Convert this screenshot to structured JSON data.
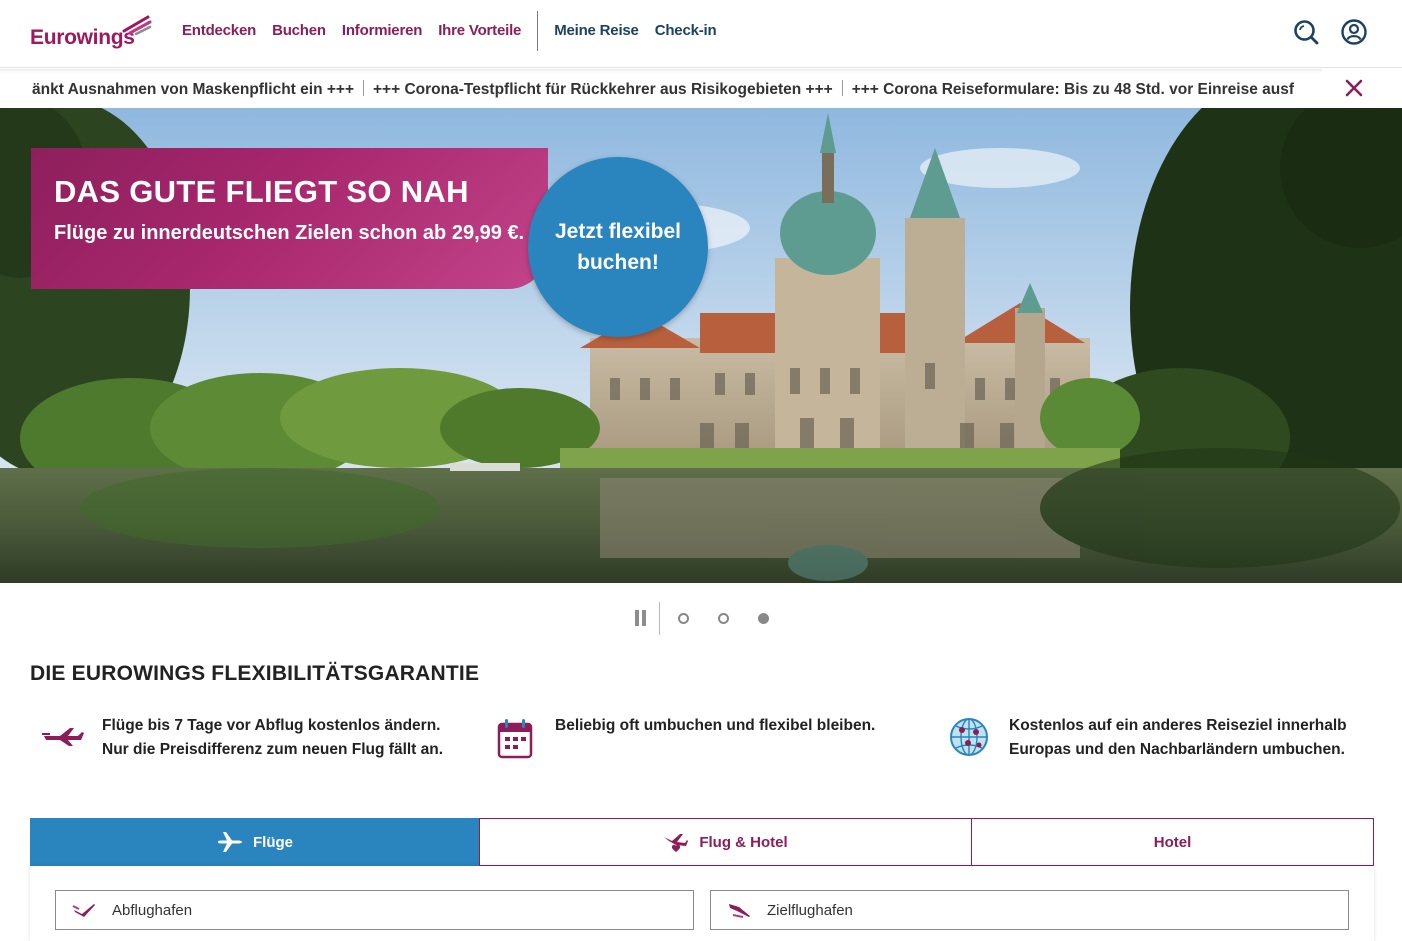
{
  "header": {
    "logo_text": "Eurowings",
    "nav_primary": [
      "Entdecken",
      "Buchen",
      "Informieren",
      "Ihre Vorteile"
    ],
    "nav_secondary": [
      "Meine Reise",
      "Check-in"
    ],
    "icons": [
      "search-icon",
      "user-account-icon"
    ],
    "brand_color": "#8c1d59",
    "secondary_color": "#1c4262"
  },
  "ticker": {
    "items": [
      "änkt Ausnahmen von Maskenpflicht ein +++",
      "+++ Corona-Testpflicht für Rückkehrer aus Risikogebieten +++",
      "+++ Corona Reiseformulare: Bis zu 48 Std. vor Einreise ausf"
    ],
    "close_icon": "close-icon"
  },
  "hero": {
    "title": "DAS GUTE FLIEGT SO NAH",
    "subtitle": "Flüge zu innerdeutschen Zielen schon ab 29,99 €.",
    "cta_line1": "Jetzt flexibel",
    "cta_line2": "buchen!",
    "cta_color": "#2a84bd",
    "promo_color": "#a8276d"
  },
  "carousel": {
    "slides": 3,
    "active_slide": 3
  },
  "guarantee": {
    "title": "DIE EUROWINGS FLEXIBILITÄTSGARANTIE",
    "features": [
      {
        "icon": "airplane-icon",
        "line1": "Flüge bis 7 Tage vor Abflug kostenlos ändern.",
        "line2": "Nur die Preisdifferenz zum neuen Flug fällt an."
      },
      {
        "icon": "calendar-icon",
        "line1": "Beliebig oft umbuchen und flexibel bleiben.",
        "line2": ""
      },
      {
        "icon": "globe-icon",
        "line1": "Kostenlos auf ein anderes Reiseziel innerhalb",
        "line2": "Europas und den Nachbarländern umbuchen."
      }
    ]
  },
  "booking": {
    "tabs": [
      {
        "label": "Flüge",
        "icon": "airplane-icon",
        "active": true
      },
      {
        "label": "Flug & Hotel",
        "icon": "plane-heart-icon",
        "active": false
      },
      {
        "label": "Hotel",
        "icon": "",
        "active": false
      }
    ],
    "fields": [
      {
        "placeholder": "Abflughafen",
        "icon": "departure-icon"
      },
      {
        "placeholder": "Zielflughafen",
        "icon": "arrival-icon"
      }
    ]
  }
}
